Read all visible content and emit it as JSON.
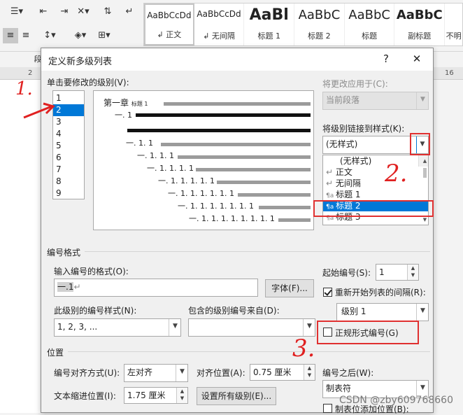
{
  "ribbon": {
    "paragraph_group_label": "段",
    "styles": [
      {
        "sample": "AaBbCcDd",
        "name": "正文"
      },
      {
        "sample": "AaBbCcDd",
        "name": "无间隔"
      },
      {
        "sample": "AaBl",
        "name": "标题 1"
      },
      {
        "sample": "AaBbC",
        "name": "标题 2"
      },
      {
        "sample": "AaBbC",
        "name": "标题"
      },
      {
        "sample": "AaBbC",
        "name": "副标题"
      },
      {
        "sample": "",
        "name": "不明"
      }
    ]
  },
  "ruler": {
    "left_mark": "2",
    "right_mark": "16"
  },
  "dialog": {
    "title": "定义新多级列表",
    "help": "?",
    "close": "✕",
    "level_label": "单击要修改的级别(V):",
    "levels": [
      "1",
      "2",
      "3",
      "4",
      "5",
      "6",
      "7",
      "8",
      "9"
    ],
    "selected_level": "2",
    "preview": {
      "rows": [
        {
          "prefix": "第一章",
          "suffix": "标题 1"
        },
        {
          "prefix": "一. 1",
          "suffix": ""
        },
        {
          "prefix": "",
          "suffix": ""
        },
        {
          "prefix": "一. 1. 1",
          "suffix": ""
        },
        {
          "prefix": "一. 1. 1. 1",
          "suffix": ""
        },
        {
          "prefix": "一. 1. 1. 1. 1",
          "suffix": ""
        },
        {
          "prefix": "一. 1. 1. 1. 1. 1",
          "suffix": ""
        },
        {
          "prefix": "一. 1. 1. 1. 1. 1. 1",
          "suffix": ""
        },
        {
          "prefix": "一. 1. 1. 1. 1. 1. 1. 1",
          "suffix": ""
        },
        {
          "prefix": "一. 1. 1. 1. 1. 1. 1. 1. 1",
          "suffix": ""
        }
      ]
    },
    "apply_to_label": "将更改应用于(C):",
    "apply_to_value": "当前段落",
    "link_style_label": "将级别链接到样式(K):",
    "link_style_value": "(无样式)",
    "style_options": [
      "(无样式)",
      "正文",
      "无间隔",
      "标题 1",
      "标题 2",
      "标题 3"
    ],
    "selected_style": "标题 2",
    "number_format_group": "编号格式",
    "format_input_label": "输入编号的格式(O):",
    "format_input_value": "一.1",
    "font_button": "字体(F)...",
    "number_style_label": "此级别的编号样式(N):",
    "number_style_value": "1, 2, 3, ...",
    "include_level_label": "包含的级别编号来自(D):",
    "include_level_value": "",
    "start_at_label": "起始编号(S):",
    "start_at_value": "1",
    "restart_label": "重新开始列表的间隔(R):",
    "restart_value": "级别 1",
    "legal_label": "正规形式编号(G)",
    "position_group": "位置",
    "alignment_label": "编号对齐方式(U):",
    "alignment_value": "左对齐",
    "align_at_label": "对齐位置(A):",
    "align_at_value": "0.75 厘米",
    "follow_label": "编号之后(W):",
    "follow_value": "制表符",
    "indent_label": "文本缩进位置(I):",
    "indent_value": "1.75 厘米",
    "set_all_button": "设置所有级别(E)...",
    "tab_stop_label": "制表位添加位置(B):"
  },
  "annotations": {
    "one": "1.",
    "two": "2.",
    "three": "3."
  },
  "watermark": "CSDN @zby609768660",
  "colors": {
    "selection": "#0078d7",
    "annotation": "#e02020"
  }
}
